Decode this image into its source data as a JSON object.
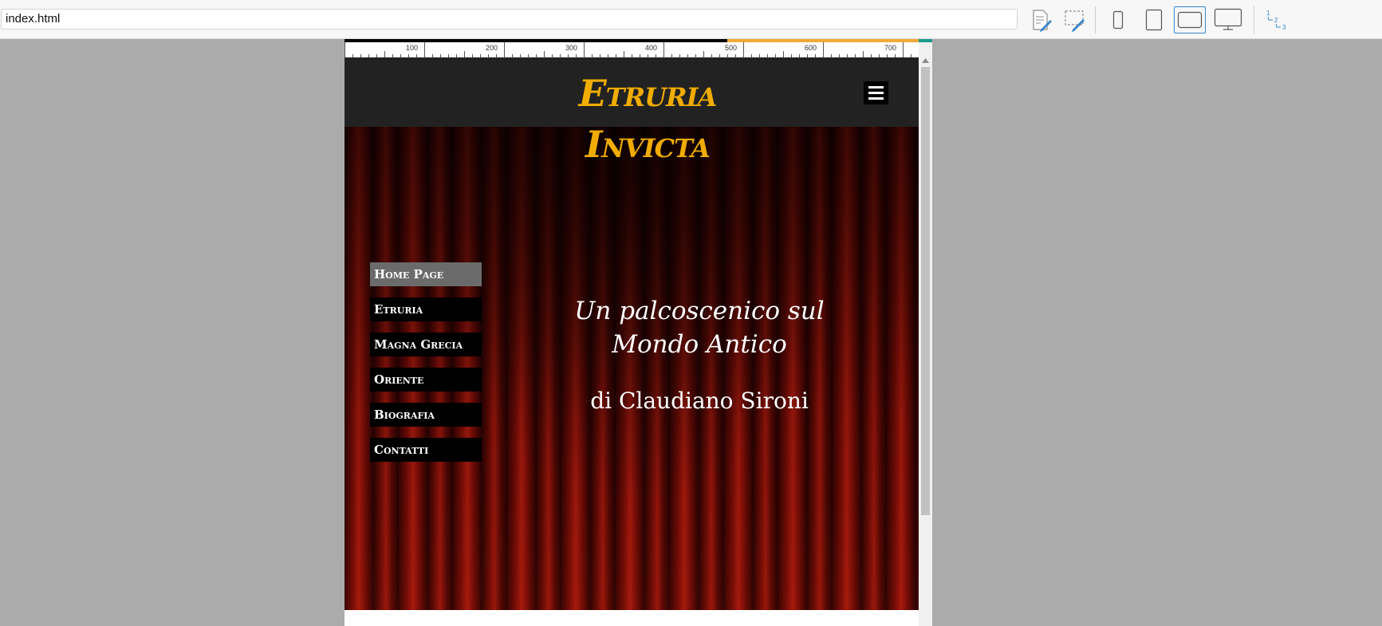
{
  "toolbar": {
    "address": "index.html",
    "buttons": [
      {
        "name": "edit-page-icon"
      },
      {
        "name": "edit-selection-icon"
      },
      {
        "name": "phone-view-icon"
      },
      {
        "name": "tablet-portrait-icon"
      },
      {
        "name": "tablet-landscape-icon"
      },
      {
        "name": "desktop-view-icon"
      },
      {
        "name": "tab-order-icon"
      }
    ],
    "accent_color": "#3a84c7"
  },
  "ruler": {
    "labels": [
      "100",
      "200",
      "300",
      "400",
      "500",
      "600",
      "700"
    ],
    "colors": [
      "#000000",
      "#f2a93b",
      "#1a9c8c"
    ]
  },
  "site": {
    "title_line1": "Etruria",
    "title_line2": "Invicta",
    "title_color": "#f0ac00",
    "nav": [
      {
        "label": "Home Page",
        "active": true
      },
      {
        "label": "Etruria",
        "active": false
      },
      {
        "label": "Magna Grecia",
        "active": false
      },
      {
        "label": "Oriente",
        "active": false
      },
      {
        "label": "Biografia",
        "active": false
      },
      {
        "label": "Contatti",
        "active": false
      }
    ],
    "tagline_line1": "Un palcoscenico sul",
    "tagline_line2": "Mondo Antico",
    "author": "di Claudiano Sironi"
  }
}
